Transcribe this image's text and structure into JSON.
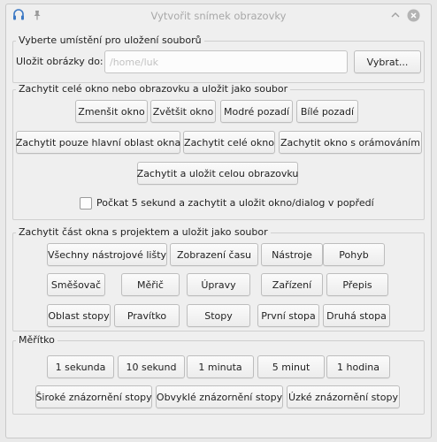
{
  "window": {
    "title": "Vytvořit snímek obrazovky",
    "icons": {
      "app": "headphones-icon",
      "pin": "pin-icon",
      "collapse": "chevron-up-icon",
      "close": "close-icon"
    }
  },
  "save_location": {
    "title": "Vyberte umístění pro uložení souborů",
    "label": "Uložit obrázky do:",
    "path_value": "/home/luk",
    "browse_button": "Vybrat..."
  },
  "full_capture": {
    "title": "Zachytit celé okno nebo obrazovku a uložit jako soubor",
    "row1": [
      "Zmenšit okno",
      "Zvětšit okno",
      "Modré pozadí",
      "Bílé pozadí"
    ],
    "row2": [
      "Zachytit pouze hlavní oblast okna",
      "Zachytit celé okno",
      "Zachytit okno s orámováním"
    ],
    "capture_screen": "Zachytit a uložit celou obrazovku",
    "delay_checkbox": {
      "label": "Počkat 5 sekund a zachytit a uložit okno/dialog v popředí",
      "checked": false
    }
  },
  "part_capture": {
    "title": "Zachytit část okna s projektem a uložit jako soubor",
    "row1": [
      "Všechny nástrojové lišty",
      "Zobrazení času",
      "Nástroje",
      "Pohyb"
    ],
    "row2": [
      "Směšovač",
      "Měřič",
      "Úpravy",
      "Zařízení",
      "Přepis"
    ],
    "row3": [
      "Oblast stopy",
      "Pravítko",
      "Stopy",
      "První stopa",
      "Druhá stopa"
    ]
  },
  "scale": {
    "title": "Měřítko",
    "row1": [
      "1 sekunda",
      "10 sekund",
      "1 minuta",
      "5 minut",
      "1 hodina"
    ],
    "row2": [
      "Široké znázornění stopy",
      "Obvyklé znázornění stopy",
      "Úzké znázornění stopy"
    ]
  }
}
